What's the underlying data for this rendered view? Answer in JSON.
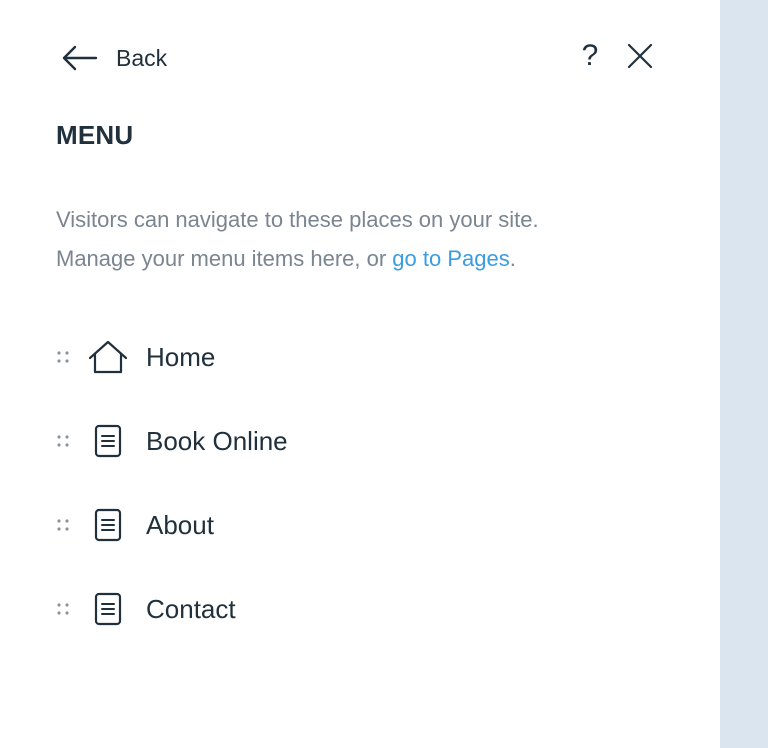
{
  "header": {
    "back_label": "Back",
    "help_label": "?",
    "back_icon": "arrow-left-icon",
    "close_icon": "close-icon"
  },
  "panel": {
    "title": "MENU",
    "description_line1": "Visitors can navigate to these places on your site.",
    "description_line2_prefix": "Manage your menu items here, or ",
    "description_link": "go to Pages",
    "description_line2_suffix": "."
  },
  "menu": {
    "items": [
      {
        "label": "Home",
        "icon": "home-icon"
      },
      {
        "label": "Book Online",
        "icon": "page-icon"
      },
      {
        "label": "About",
        "icon": "page-icon"
      },
      {
        "label": "Contact",
        "icon": "page-icon"
      }
    ]
  },
  "colors": {
    "text": "#20303c",
    "muted": "#7a8591",
    "link": "#3a9ce1",
    "side_strip": "#dbe5f0"
  }
}
